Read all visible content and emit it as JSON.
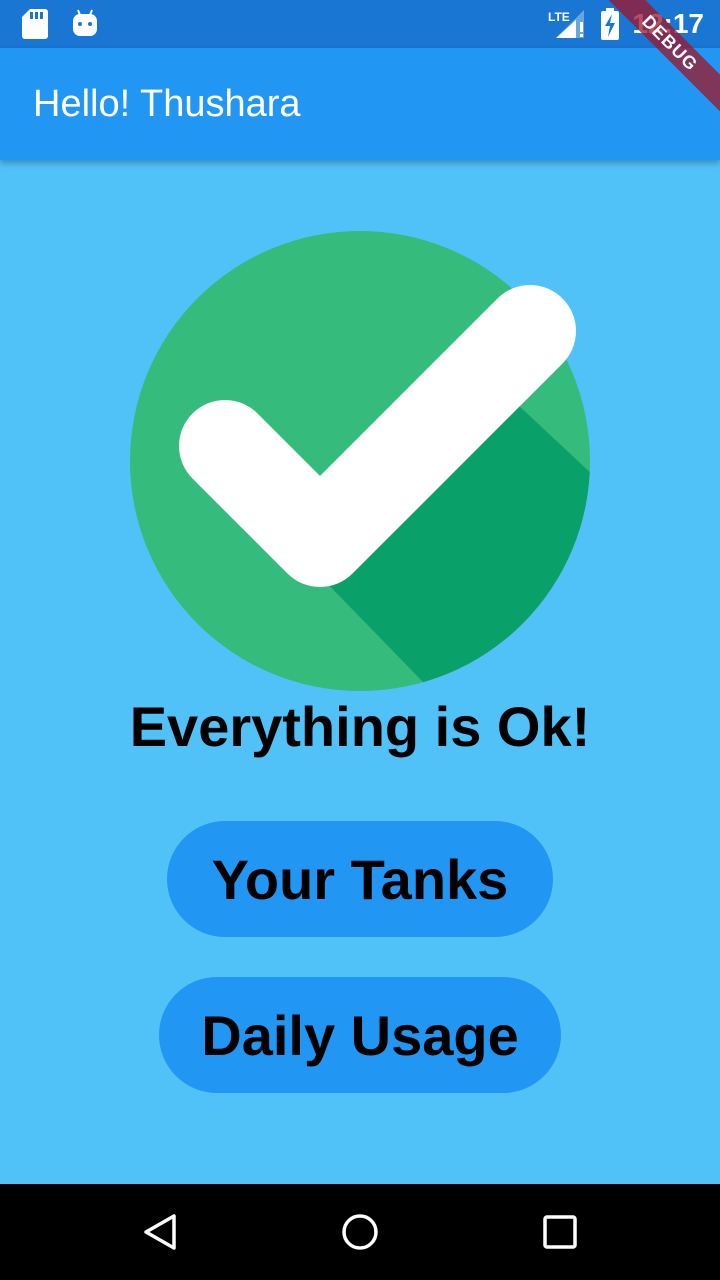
{
  "status_bar": {
    "time": "12:17",
    "network_label": "LTE",
    "icons": [
      "sd-card-icon",
      "android-icon",
      "signal-icon",
      "battery-charging-icon"
    ]
  },
  "app_bar": {
    "title": "Hello! Thushara",
    "debug_banner": "DEBUG"
  },
  "main": {
    "status_icon": "check-circle-icon",
    "status_message": "Everything is Ok!",
    "buttons": [
      {
        "label": "Your Tanks"
      },
      {
        "label": "Daily Usage"
      }
    ]
  },
  "nav_bar": {
    "icons": [
      "back-icon",
      "home-icon",
      "recents-icon"
    ]
  },
  "colors": {
    "status_bar": "#1976d2",
    "app_bar": "#2196f3",
    "background": "#50c2f8",
    "button": "#2196f3",
    "check_circle": "#35bb7c",
    "check_shadow": "#0aa06a",
    "nav_bar": "#000000"
  }
}
